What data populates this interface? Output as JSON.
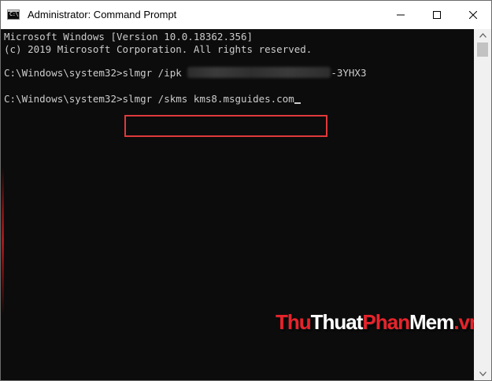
{
  "window": {
    "title": "Administrator: Command Prompt",
    "icon_text": "C:\\"
  },
  "console": {
    "line1": "Microsoft Windows [Version 10.0.18362.356]",
    "line2": "(c) 2019 Microsoft Corporation. All rights reserved.",
    "line3_prompt": "C:\\Windows\\system32>",
    "line3_command": "slmgr /ipk ",
    "line3_suffix": "-3YHX3",
    "line4_prompt": "C:\\Windows\\system32>",
    "line4_command": "slmgr /skms kms8.msguides.com"
  },
  "watermark": {
    "part1": "Thu",
    "part2": "Thuat",
    "part3": "Phan",
    "part4": "Mem",
    "part5": ".vn"
  },
  "colors": {
    "console_bg": "#0c0c0c",
    "console_text": "#cccccc",
    "highlight": "#e0393c",
    "watermark_red": "#e8232b"
  },
  "icons": {
    "app": "cmd-icon",
    "minimize": "minimize-icon",
    "maximize": "maximize-icon",
    "close": "close-icon",
    "scroll_up": "chevron-up-icon",
    "scroll_down": "chevron-down-icon"
  }
}
